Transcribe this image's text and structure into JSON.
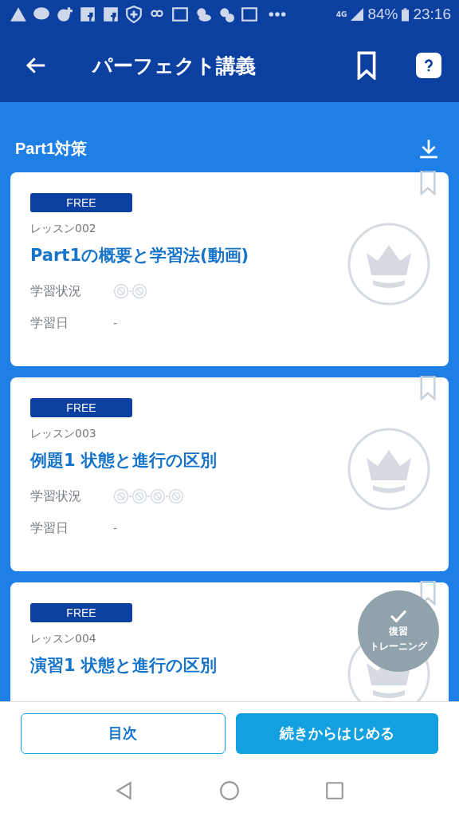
{
  "status_bar": {
    "network": "4G",
    "battery": "84%",
    "time": "23:16"
  },
  "app_bar": {
    "title": "パーフェクト講義"
  },
  "section": {
    "title": "Part1対策"
  },
  "lessons": [
    {
      "badge": "FREE",
      "number": "レッスン002",
      "title": "Part1の概要と学習法(動画)",
      "status_label": "学習状況",
      "progress": [
        {
          "done": false
        },
        {
          "done": false
        }
      ],
      "date_label": "学習日",
      "date": "-",
      "bookmarked": false
    },
    {
      "badge": "FREE",
      "number": "レッスン003",
      "title": "例題1 状態と進行の区別",
      "status_label": "学習状況",
      "progress": [
        {
          "done": false
        },
        {
          "done": false
        },
        {
          "done": false
        },
        {
          "done": false
        }
      ],
      "date_label": "学習日",
      "date": "-",
      "bookmarked": false
    },
    {
      "badge": "FREE",
      "number": "レッスン004",
      "title": "演習1 状態と進行の区別",
      "bookmarked": false,
      "review_badge": [
        "復習",
        "トレーニング"
      ]
    }
  ],
  "buttons": [
    {
      "label": "目次",
      "kind": "outline"
    },
    {
      "label": "続きからはじめる",
      "kind": "primary"
    }
  ]
}
